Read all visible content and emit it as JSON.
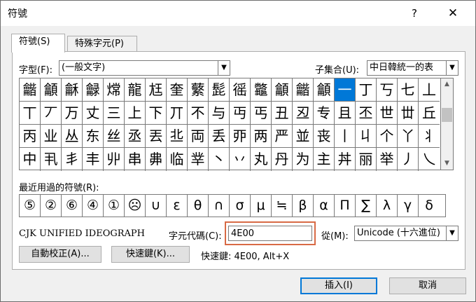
{
  "window": {
    "title": "符號",
    "help_label": "?",
    "close_label": "✕"
  },
  "tabs": [
    {
      "label": "符號(S)"
    },
    {
      "label": "特殊字元(P)"
    }
  ],
  "font": {
    "label": "字型(F):",
    "value": "(一般文字)"
  },
  "subset": {
    "label": "子集合(U):",
    "value": "中日韓統一的表"
  },
  "symbol_grid": {
    "rows": [
      [
        "龤",
        "龥",
        "龢",
        "龣",
        "龦",
        "龍",
        "尪",
        "奎",
        "蘩",
        "髭",
        "徭",
        "龞",
        "龥",
        "龤",
        "龥",
        "一",
        "丁",
        "丂",
        "七",
        "丄"
      ],
      [
        "丅",
        "丆",
        "万",
        "丈",
        "三",
        "上",
        "下",
        "丌",
        "不",
        "与",
        "丏",
        "丐",
        "丑",
        "丒",
        "专",
        "且",
        "丕",
        "世",
        "丗",
        "丘"
      ],
      [
        "丙",
        "业",
        "丛",
        "东",
        "丝",
        "丞",
        "丟",
        "丠",
        "両",
        "丢",
        "丣",
        "两",
        "严",
        "並",
        "丧",
        "丨",
        "丩",
        "个",
        "丫",
        "丬"
      ],
      [
        "中",
        "丮",
        "丯",
        "丰",
        "丱",
        "串",
        "丳",
        "临",
        "丵",
        "丶",
        "丷",
        "丸",
        "丹",
        "为",
        "主",
        "丼",
        "丽",
        "举",
        "丿",
        "乀"
      ]
    ],
    "selected_row": 0,
    "selected_col": 15
  },
  "recent": {
    "label": "最近用過的符號(R):",
    "symbols": [
      "⑤",
      "②",
      "⑥",
      "④",
      "①",
      "☹",
      "∪",
      "ε",
      "θ",
      "∩",
      "σ",
      "μ",
      "≒",
      "β",
      "α",
      "Π",
      "∑",
      "λ",
      "γ",
      "δ"
    ]
  },
  "char_name": "CJK UNIFIED IDEOGRAPH",
  "char_code": {
    "label": "字元代碼(C):",
    "value": "4E00"
  },
  "from": {
    "label": "從(M):",
    "value": "Unicode (十六進位)"
  },
  "buttons": {
    "autocorrect": "自動校正(A)...",
    "shortcut_key": "快速鍵(K)...",
    "insert": "插入(I)",
    "cancel": "取消"
  },
  "shortcut_text": "快速鍵: 4E00, Alt+X"
}
